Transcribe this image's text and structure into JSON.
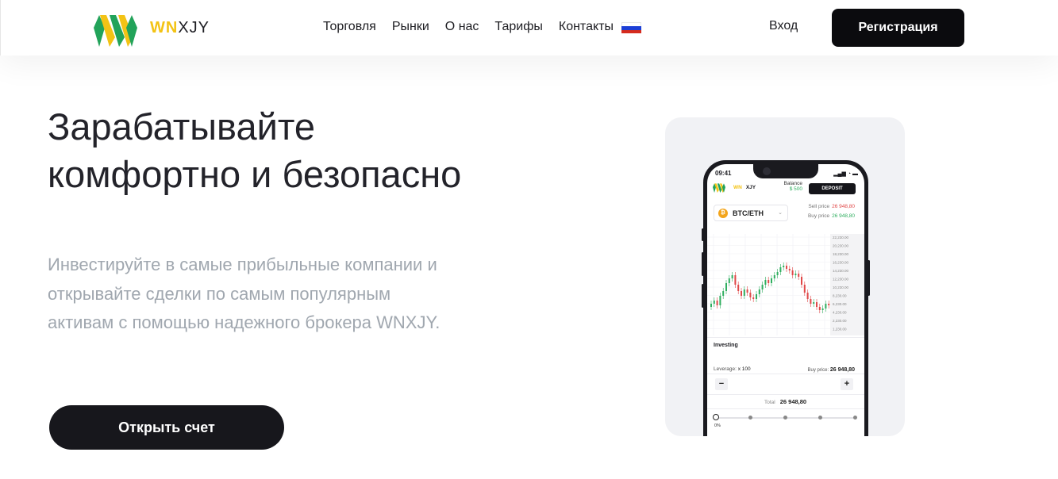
{
  "header": {
    "logo": {
      "part1": "WN",
      "part2": "XJY"
    },
    "nav": [
      "Торговля",
      "Рынки",
      "О нас",
      "Тарифы",
      "Контакты"
    ],
    "login": "Вход",
    "register": "Регистрация",
    "flag_colors": [
      "#ffffff",
      "#1c3fd6",
      "#d52b1e"
    ]
  },
  "hero": {
    "title": "Зарабатывайте комфортно и безопасно",
    "subtitle": "Инвестируйте в самые прибыльные компании и открывайте сделки по самым популярным активам с помощью надежного брокера WNXJY.",
    "cta": "Открыть счет"
  },
  "phone": {
    "time": "09:41",
    "logo": {
      "part1": "WN",
      "part2": "XJY"
    },
    "balance_label": "Balance",
    "balance_value": "$ 500",
    "deposit": "DEPOSIT",
    "pair": "BTC/ETH",
    "coin_symbol": "₿",
    "sell_label": "Sell price",
    "sell_value": "26 948,80",
    "buy_label": "Buy price",
    "buy_value": "26 948,80",
    "price_axis": [
      "22,230.00",
      "20,230.00",
      "18,230.00",
      "16,230.00",
      "14,230.00",
      "12,230.00",
      "10,230.00",
      "8,230.00",
      "6,230.00",
      "4,230.00",
      "2,230.00",
      "1,230.00"
    ],
    "investing": "Investing",
    "leverage_label": "Leverage:",
    "leverage_value": "x 100",
    "buy_price_label": "Buy price:",
    "buy_price_value": "26 948,80",
    "minus": "−",
    "plus": "+",
    "total_label": "Total",
    "total_value": "26 948,80",
    "slider_value": "0%"
  },
  "colors": {
    "accent_yellow": "#f3c315",
    "accent_green": "#22a35a",
    "candle_up": "#2fae5f",
    "candle_down": "#e04848",
    "dark_button": "#0b0b0e"
  }
}
